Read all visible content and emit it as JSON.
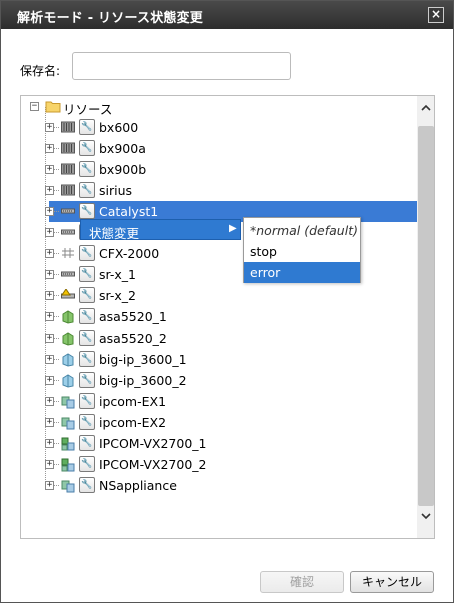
{
  "dialog": {
    "title": "解析モード - リソース状態変更",
    "close_glyph": "×"
  },
  "save": {
    "label": "保存名:",
    "value": "",
    "placeholder": ""
  },
  "tree": {
    "root_label": "リソース",
    "nodes": [
      {
        "label": "bx600",
        "icon": "chassis-icon"
      },
      {
        "label": "bx900a",
        "icon": "chassis-icon"
      },
      {
        "label": "bx900b",
        "icon": "chassis-icon"
      },
      {
        "label": "sirius",
        "icon": "chassis-icon"
      },
      {
        "label": "Catalyst1",
        "icon": "switch-icon",
        "selected": true
      },
      {
        "label": "",
        "icon": "switch-icon"
      },
      {
        "label": "CFX-2000",
        "icon": "fabric-icon"
      },
      {
        "label": "sr-x_1",
        "icon": "switch-icon"
      },
      {
        "label": "sr-x_2",
        "icon": "switch-warning-icon"
      },
      {
        "label": "asa5520_1",
        "icon": "firewall-icon"
      },
      {
        "label": "asa5520_2",
        "icon": "firewall-icon"
      },
      {
        "label": "big-ip_3600_1",
        "icon": "loadbalancer-icon"
      },
      {
        "label": "big-ip_3600_2",
        "icon": "loadbalancer-icon"
      },
      {
        "label": "ipcom-EX1",
        "icon": "ipcom-icon"
      },
      {
        "label": "ipcom-EX2",
        "icon": "ipcom-icon"
      },
      {
        "label": "IPCOM-VX2700_1",
        "icon": "ipcom-vx-icon"
      },
      {
        "label": "IPCOM-VX2700_2",
        "icon": "ipcom-vx-icon"
      },
      {
        "label": "NSappliance",
        "icon": "ipcom-icon"
      }
    ]
  },
  "context_menu": {
    "item_label": "状態変更",
    "submenu": [
      {
        "label": "*normal (default)"
      },
      {
        "label": "stop"
      },
      {
        "label": "error",
        "active": true
      }
    ]
  },
  "buttons": {
    "confirm_label": "確認",
    "cancel_label": "キャンセル"
  },
  "colors": {
    "selection": "#3a7bd5",
    "title_bar": "#3a3a3a"
  }
}
